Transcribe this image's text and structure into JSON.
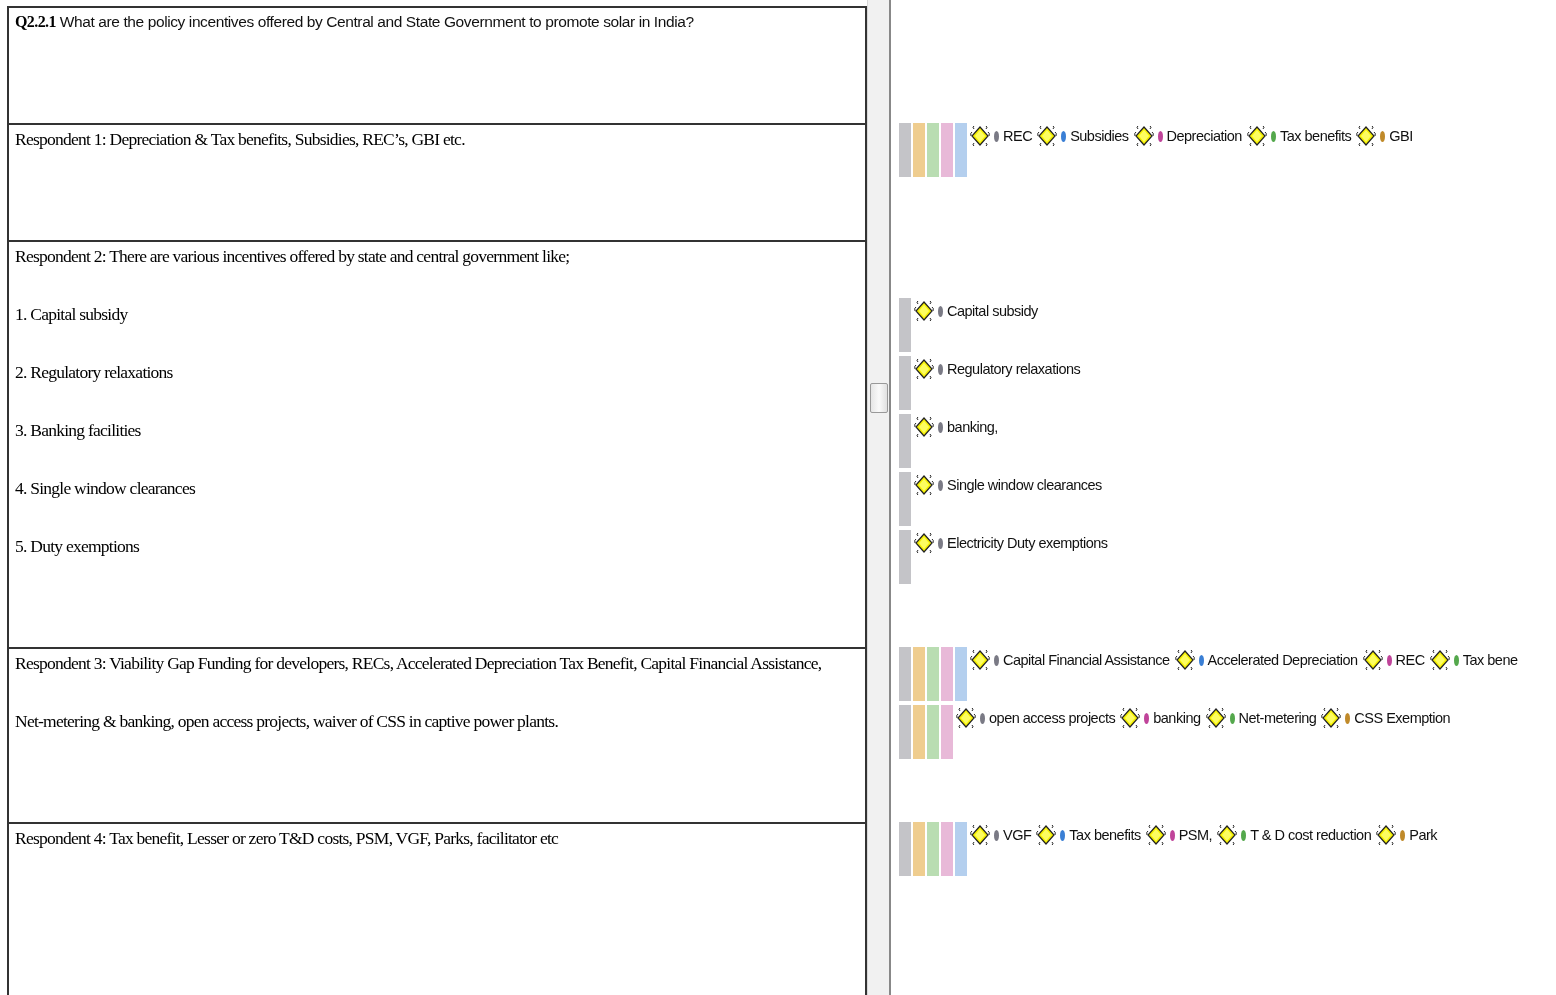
{
  "question": {
    "label": "Q2.2.1",
    "text": "What are the policy incentives offered by Central and State Government to promote solar in India?"
  },
  "responses": [
    {
      "lines": [
        {
          "text": "Respondent 1: Depreciation & Tax benefits, Subsidies, REC’s,  GBI etc.",
          "bars": [
            {
              "color": "#c4c4c8"
            },
            {
              "color": "#efcd8f"
            },
            {
              "color": "#b9ddb2"
            },
            {
              "color": "#e8b9d8"
            },
            {
              "color": "#b4cfee"
            }
          ],
          "codes": [
            {
              "name": "REC",
              "color": "#7a7a85"
            },
            {
              "name": "Subsidies",
              "color": "#3a7fd5"
            },
            {
              "name": "Depreciation",
              "color": "#c0449a"
            },
            {
              "name": "Tax benefits",
              "color": "#54a84c"
            },
            {
              "name": "GBI",
              "color": "#c08a2a"
            }
          ]
        }
      ]
    },
    {
      "lines": [
        {
          "text": "Respondent 2: There are various incentives offered by state and central government like;"
        },
        {
          "text": "1. Capital subsidy",
          "bars": [
            {
              "color": "#c4c4c8"
            }
          ],
          "codes": [
            {
              "name": "Capital subsidy",
              "color": "#7a7a85"
            }
          ]
        },
        {
          "text": "2. Regulatory relaxations",
          "bars": [
            {
              "color": "#c4c4c8"
            }
          ],
          "codes": [
            {
              "name": "Regulatory relaxations",
              "color": "#7a7a85"
            }
          ]
        },
        {
          "text": "3. Banking facilities",
          "bars": [
            {
              "color": "#c4c4c8"
            }
          ],
          "codes": [
            {
              "name": "banking,",
              "color": "#7a7a85"
            }
          ]
        },
        {
          "text": "4. Single window clearances",
          "bars": [
            {
              "color": "#c4c4c8"
            }
          ],
          "codes": [
            {
              "name": "Single window clearances",
              "color": "#7a7a85"
            }
          ]
        },
        {
          "text": "5. Duty exemptions",
          "bars": [
            {
              "color": "#c4c4c8"
            }
          ],
          "codes": [
            {
              "name": "Electricity Duty exemptions",
              "color": "#7a7a85"
            }
          ]
        }
      ]
    },
    {
      "lines": [
        {
          "text": "Respondent 3: Viability Gap Funding for developers, RECs, Accelerated Depreciation Tax Benefit, Capital Financial Assistance,",
          "bars": [
            {
              "color": "#c4c4c8"
            },
            {
              "color": "#efcd8f"
            },
            {
              "color": "#b9ddb2"
            },
            {
              "color": "#e8b9d8"
            },
            {
              "color": "#b4cfee"
            }
          ],
          "codes": [
            {
              "name": "Capital Financial Assistance",
              "color": "#7a7a85"
            },
            {
              "name": "Accelerated Depreciation",
              "color": "#3a7fd5"
            },
            {
              "name": "REC",
              "color": "#c0449a"
            },
            {
              "name": "Tax bene",
              "color": "#54a84c"
            }
          ]
        },
        {
          "text": "Net-metering & banking, open access projects, waiver of CSS in captive power plants.",
          "bars": [
            {
              "color": "#c4c4c8"
            },
            {
              "color": "#efcd8f"
            },
            {
              "color": "#b9ddb2"
            },
            {
              "color": "#e8b9d8"
            }
          ],
          "codes": [
            {
              "name": "open access projects",
              "color": "#7a7a85"
            },
            {
              "name": "banking",
              "color": "#c0449a"
            },
            {
              "name": "Net-metering",
              "color": "#54a84c"
            },
            {
              "name": "CSS Exemption",
              "color": "#c08a2a"
            }
          ]
        }
      ]
    },
    {
      "lines": [
        {
          "text": "Respondent 4: Tax benefit, Lesser or zero T&D costs, PSM, VGF, Parks, facilitator etc",
          "bars": [
            {
              "color": "#c4c4c8"
            },
            {
              "color": "#efcd8f"
            },
            {
              "color": "#b9ddb2"
            },
            {
              "color": "#e8b9d8"
            },
            {
              "color": "#b4cfee"
            }
          ],
          "codes": [
            {
              "name": "VGF",
              "color": "#7a7a85"
            },
            {
              "name": "Tax benefits",
              "color": "#3a7fd5"
            },
            {
              "name": "PSM,",
              "color": "#c0449a"
            },
            {
              "name": "T & D cost reduction",
              "color": "#54a84c"
            },
            {
              "name": "Park",
              "color": "#c08a2a"
            }
          ]
        }
      ]
    }
  ]
}
